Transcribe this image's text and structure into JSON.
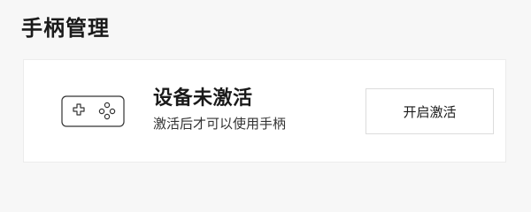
{
  "page": {
    "title": "手柄管理"
  },
  "gamepad_card": {
    "icon": "gamepad-icon",
    "status_title": "设备未激活",
    "status_desc": "激活后才可以使用手柄",
    "activate_label": "开启激活"
  },
  "colors": {
    "background": "#f7f7f7",
    "card": "#ffffff",
    "text": "#1a1a1a",
    "border": "#dcdcdc"
  }
}
